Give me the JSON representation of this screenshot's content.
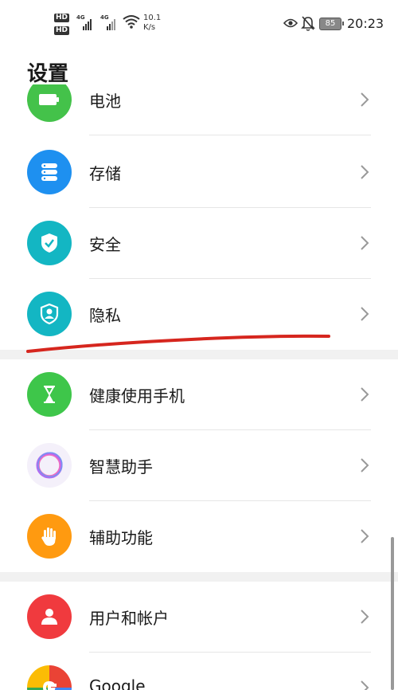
{
  "status_bar": {
    "hd1": "HD",
    "hd2": "HD",
    "signal1_type": "4G",
    "signal2_type": "4G",
    "net_speed_value": "10.1",
    "net_speed_unit": "K/s",
    "battery": "85",
    "time": "20:23",
    "icons": [
      "wifi-icon",
      "eye-icon",
      "bell-off-icon",
      "battery-icon"
    ]
  },
  "page": {
    "title": "设置"
  },
  "settings_items": [
    {
      "label": "电池",
      "icon": "battery-item-icon",
      "color": "#44c24a"
    },
    {
      "label": "存储",
      "icon": "storage-icon",
      "color": "#1e90f0"
    },
    {
      "label": "安全",
      "icon": "shield-icon",
      "color": "#13b6c3"
    },
    {
      "label": "隐私",
      "icon": "privacy-icon",
      "color": "#13b6c3"
    },
    {
      "label": "健康使用手机",
      "icon": "hourglass-icon",
      "color": "#3ec64a"
    },
    {
      "label": "智慧助手",
      "icon": "assistant-ring-icon",
      "color": "#b06cf0"
    },
    {
      "label": "辅助功能",
      "icon": "hand-icon",
      "color": "#ff9a10"
    },
    {
      "label": "用户和帐户",
      "icon": "user-icon",
      "color": "#f03a3e"
    },
    {
      "label": "Google",
      "icon": "google-icon",
      "color": "#4285f4"
    }
  ],
  "annotation": {
    "color": "#d6261e"
  }
}
